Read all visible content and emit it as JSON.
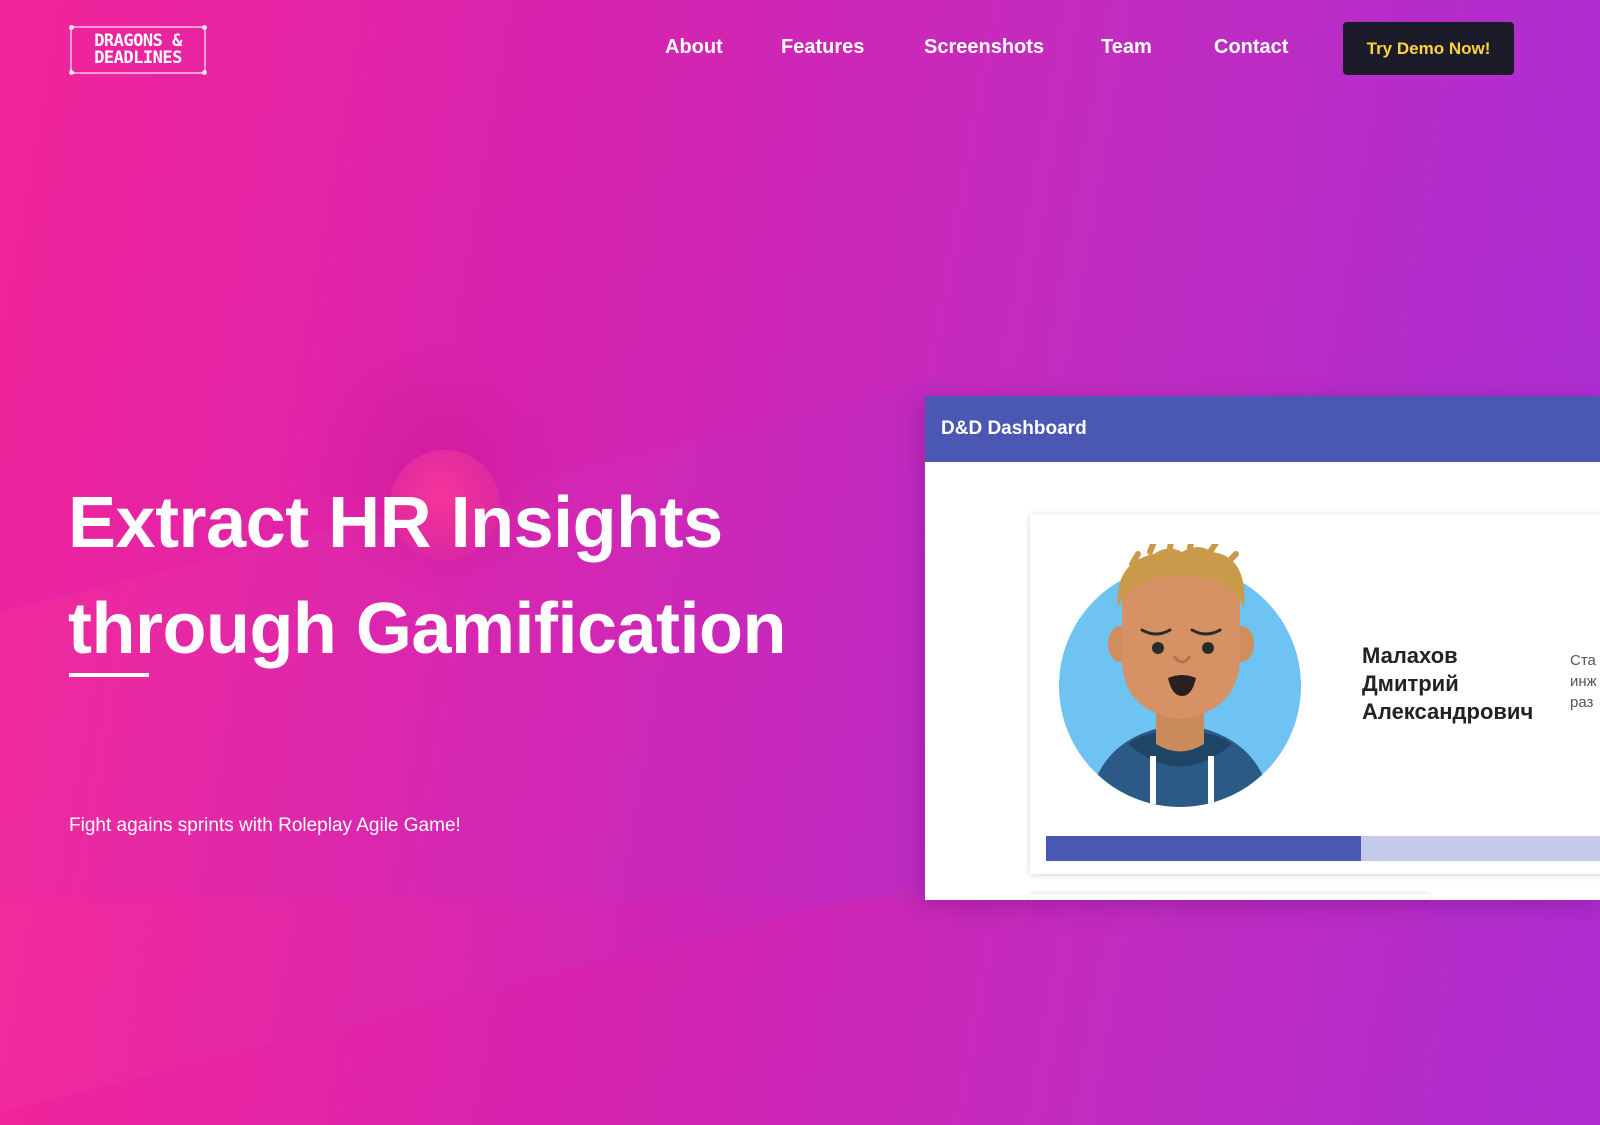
{
  "brand": {
    "logo_text": "DRAGONS &\nDEADLINES"
  },
  "nav": {
    "links": [
      "About",
      "Features",
      "Screenshots",
      "Team",
      "Contact"
    ],
    "cta_label": "Try Demo Now!"
  },
  "hero": {
    "title_line1": "Extract HR Insights",
    "title_line2": "through Gamification",
    "subtitle": "Fight agains sprints with Roleplay Agile Game!"
  },
  "dashboard": {
    "title": "D&D Dashboard",
    "profile": {
      "name_lines": [
        "Малахов",
        "Дмитрий",
        "Александрович"
      ],
      "role_lines_partial": [
        "Ста",
        "инж",
        "раз"
      ],
      "progress": 0.54
    }
  },
  "colors": {
    "accent": "#4a58b4",
    "cta_bg": "#1c1b2a",
    "cta_text": "#ffd33d",
    "gradient_start": "#f2249a",
    "gradient_end": "#a92dd4"
  }
}
